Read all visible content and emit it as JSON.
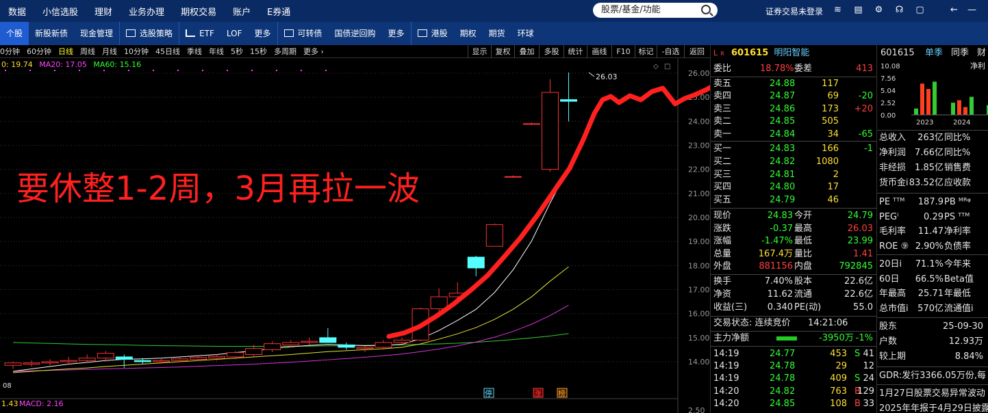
{
  "topbar": {
    "menu": [
      "数据",
      "小信选股",
      "理财",
      "业务办理",
      "期权交易",
      "账户",
      "E券通"
    ],
    "search_placeholder": "股票/基金/功能",
    "login_status": "证券交易未登录"
  },
  "secbar": {
    "items": [
      "个股",
      "新股新债",
      "现金管理",
      "选股策略",
      "ETF",
      "LOF",
      "更多",
      "可转债",
      "国债逆回购",
      "更多",
      "港股",
      "期权",
      "期货",
      "环球"
    ]
  },
  "periodbar": {
    "periods": [
      "0分钟",
      "60分钟",
      "日线",
      "周线",
      "月线",
      "10分钟",
      "45日线",
      "季线",
      "年线",
      "5秒",
      "15秒",
      "多周期",
      "更多 ›"
    ],
    "active": "日线",
    "buttons": [
      "显示",
      "复权",
      "叠加",
      "多股",
      "统计",
      "画线",
      "F10",
      "标记",
      "-自选",
      "返回"
    ]
  },
  "ma_legend": {
    "ma10": "0: 19.74",
    "ma20": "MA20: 17.05",
    "ma60": "MA60: 15.16"
  },
  "annotation_text": "要休整1-2周，3月再拉一波",
  "macd_legend": {
    "left": "1.43",
    "label": "MACD: 2.16"
  },
  "left_edge_label": "08",
  "price_axis": [
    "26.00",
    "25.00",
    "24.00",
    "23.00",
    "22.00",
    "21.00",
    "20.00",
    "19.00",
    "18.00",
    "17.00",
    "16.00",
    "15.00",
    "14.00",
    "2.50"
  ],
  "high_marker": "26.03",
  "event_markers": [
    {
      "text": "停",
      "color": "#66e0ff"
    },
    {
      "text": "涨",
      "color": "#ff4040"
    },
    {
      "text": "榜",
      "color": "#ffa030"
    }
  ],
  "chart_data": {
    "type": "candlestick",
    "ylim": [
      13.7,
      26.3
    ],
    "candles": [
      {
        "o": 13.85,
        "h": 14.0,
        "l": 13.7,
        "c": 13.95
      },
      {
        "o": 13.9,
        "h": 14.05,
        "l": 13.8,
        "c": 13.95
      },
      {
        "o": 13.95,
        "h": 14.1,
        "l": 13.85,
        "c": 14.0
      },
      {
        "o": 14.0,
        "h": 14.2,
        "l": 13.9,
        "c": 14.05
      },
      {
        "o": 14.05,
        "h": 14.3,
        "l": 13.95,
        "c": 14.15
      },
      {
        "o": 14.15,
        "h": 14.45,
        "l": 14.0,
        "c": 14.35
      },
      {
        "o": 14.2,
        "h": 14.3,
        "l": 13.75,
        "c": 14.1
      },
      {
        "o": 14.05,
        "h": 14.15,
        "l": 13.9,
        "c": 14.0
      },
      {
        "o": 14.0,
        "h": 14.12,
        "l": 13.92,
        "c": 14.05
      },
      {
        "o": 14.05,
        "h": 14.2,
        "l": 13.98,
        "c": 14.12
      },
      {
        "o": 14.1,
        "h": 14.25,
        "l": 14.02,
        "c": 14.18
      },
      {
        "o": 14.15,
        "h": 14.3,
        "l": 14.05,
        "c": 14.22
      },
      {
        "o": 14.2,
        "h": 14.45,
        "l": 14.1,
        "c": 14.38
      },
      {
        "o": 14.3,
        "h": 14.7,
        "l": 14.2,
        "c": 14.55
      },
      {
        "o": 14.5,
        "h": 14.85,
        "l": 14.4,
        "c": 14.75
      },
      {
        "o": 14.7,
        "h": 14.9,
        "l": 14.6,
        "c": 14.8
      },
      {
        "o": 14.8,
        "h": 15.0,
        "l": 14.7,
        "c": 14.85
      },
      {
        "o": 15.0,
        "h": 15.4,
        "l": 14.8,
        "c": 14.8
      },
      {
        "o": 14.7,
        "h": 14.8,
        "l": 14.5,
        "c": 14.6
      },
      {
        "o": 14.55,
        "h": 14.65,
        "l": 14.4,
        "c": 14.6
      },
      {
        "o": 14.6,
        "h": 14.9,
        "l": 14.5,
        "c": 14.8
      },
      {
        "o": 14.8,
        "h": 15.0,
        "l": 14.7,
        "c": 14.9
      },
      {
        "o": 14.9,
        "h": 16.25,
        "l": 14.85,
        "c": 16.2
      },
      {
        "o": 16.2,
        "h": 17.05,
        "l": 16.05,
        "c": 16.7
      },
      {
        "o": 16.7,
        "h": 17.3,
        "l": 16.4,
        "c": 16.85
      },
      {
        "o": 18.35,
        "h": 18.4,
        "l": 17.55,
        "c": 17.9
      },
      {
        "o": 18.8,
        "h": 19.75,
        "l": 18.8,
        "c": 19.7
      },
      {
        "o": 21.7,
        "h": 21.75,
        "l": 21.65,
        "c": 21.7
      },
      {
        "o": 23.9,
        "h": 23.95,
        "l": 23.85,
        "c": 23.9
      },
      {
        "o": 22.0,
        "h": 25.75,
        "l": 21.9,
        "c": 25.2
      },
      {
        "o": 24.9,
        "h": 26.03,
        "l": 23.99,
        "c": 24.83
      }
    ],
    "ma10": [
      13.6,
      13.7,
      13.8,
      13.9,
      13.97,
      14.05,
      14.1,
      14.12,
      14.15,
      14.2,
      14.25,
      14.3,
      14.38,
      14.45,
      14.55,
      14.62,
      14.68,
      14.72,
      14.7,
      14.67,
      14.68,
      14.72,
      14.95,
      15.3,
      15.72,
      16.18,
      16.88,
      17.82,
      19.02,
      20.6,
      22.05
    ],
    "ma20": [
      13.55,
      13.6,
      13.65,
      13.7,
      13.74,
      13.8,
      13.85,
      13.9,
      13.95,
      14.0,
      14.05,
      14.1,
      14.15,
      14.2,
      14.25,
      14.3,
      14.36,
      14.42,
      14.46,
      14.5,
      14.54,
      14.6,
      14.74,
      14.94,
      15.16,
      15.42,
      15.76,
      16.18,
      16.7,
      17.35,
      17.95
    ],
    "ma60": [
      13.6,
      13.62,
      13.64,
      13.66,
      13.68,
      13.7,
      13.72,
      13.74,
      13.76,
      13.78,
      13.81,
      13.84,
      13.87,
      13.9,
      13.94,
      13.98,
      14.03,
      14.08,
      14.13,
      14.19,
      14.25,
      14.32,
      14.42,
      14.53,
      14.66,
      14.82,
      15.02,
      15.26,
      15.56,
      15.92,
      16.35
    ],
    "ma_green": [
      14.8,
      14.78,
      14.76,
      14.74,
      14.72,
      14.71,
      14.7,
      14.68,
      14.67,
      14.66,
      14.65,
      14.64,
      14.64,
      14.64,
      14.64,
      14.64,
      14.65,
      14.66,
      14.67,
      14.68,
      14.69,
      14.7,
      14.72,
      14.74,
      14.77,
      14.81,
      14.86,
      14.92,
      14.99,
      15.07,
      15.17
    ]
  },
  "quote": {
    "code": "601615",
    "name": "明阳智能",
    "weibi_label": "委比",
    "weibi_value": "18.78%",
    "weicha_label": "委差",
    "weicha_value": "413",
    "asks": [
      {
        "label": "卖五",
        "price": "24.88",
        "vol": "117",
        "chg": ""
      },
      {
        "label": "卖四",
        "price": "24.87",
        "vol": "69",
        "chg": "-20"
      },
      {
        "label": "卖三",
        "price": "24.86",
        "vol": "173",
        "chg": "+20"
      },
      {
        "label": "卖二",
        "price": "24.85",
        "vol": "505",
        "chg": ""
      },
      {
        "label": "卖一",
        "price": "24.84",
        "vol": "34",
        "chg": "-65"
      }
    ],
    "bids": [
      {
        "label": "买一",
        "price": "24.83",
        "vol": "166",
        "chg": "-1"
      },
      {
        "label": "买二",
        "price": "24.82",
        "vol": "1080",
        "chg": ""
      },
      {
        "label": "买三",
        "price": "24.81",
        "vol": "2",
        "chg": ""
      },
      {
        "label": "买四",
        "price": "24.80",
        "vol": "17",
        "chg": ""
      },
      {
        "label": "买五",
        "price": "24.79",
        "vol": "46",
        "chg": ""
      }
    ],
    "stats": [
      {
        "l1": "现价",
        "v1": "24.83",
        "c1": "green",
        "l2": "今开",
        "v2": "24.79",
        "c2": "green"
      },
      {
        "l1": "涨跌",
        "v1": "-0.37",
        "c1": "green",
        "l2": "最高",
        "v2": "26.03",
        "c2": "red"
      },
      {
        "l1": "涨幅",
        "v1": "-1.47%",
        "c1": "green",
        "l2": "最低",
        "v2": "23.99",
        "c2": "green"
      },
      {
        "l1": "总量",
        "v1": "167.4万",
        "c1": "yellow",
        "l2": "量比",
        "v2": "1.41",
        "c2": "red"
      },
      {
        "l1": "外盘",
        "v1": "881156",
        "c1": "red",
        "l2": "内盘",
        "v2": "792845",
        "c2": "green"
      }
    ],
    "stats2": [
      {
        "l1": "换手",
        "v1": "7.40%",
        "l2": "股本",
        "v2": "22.6亿"
      },
      {
        "l1": "净资",
        "v1": "11.62",
        "l2": "流通",
        "v2": "22.6亿"
      },
      {
        "l1": "收益(三)",
        "v1": "0.340",
        "l2": "PE(动)",
        "v2": "55.0"
      }
    ],
    "trade_status_label": "交易状态: 连续竞价",
    "trade_time": "14:21:06",
    "net_label": "主力净额",
    "net_value": "-3950万",
    "net_pct": "-1%",
    "ticks": [
      {
        "time": "14:19",
        "price": "24.77",
        "vol": "453",
        "side": "S",
        "n": "41"
      },
      {
        "time": "14:19",
        "price": "24.78",
        "vol": "29",
        "side": "",
        "n": "12"
      },
      {
        "time": "14:19",
        "price": "24.78",
        "vol": "409",
        "side": "S",
        "n": "24"
      },
      {
        "time": "14:20",
        "price": "24.82",
        "vol": "763",
        "side": "B",
        "n": "129"
      },
      {
        "time": "14:20",
        "price": "24.85",
        "vol": "108",
        "side": "B",
        "n": "33"
      }
    ]
  },
  "finance": {
    "code": "601615",
    "tabs": [
      "单季",
      "同季",
      "财"
    ],
    "net_label": "净利",
    "axis": [
      "10.08",
      "7.56",
      "5.04",
      "2.52",
      "0.00"
    ],
    "years": [
      "2023",
      "2024"
    ],
    "bars_2023": [
      1.3,
      6.4,
      5.3,
      6.8
    ],
    "bars_2024": [
      2.5,
      3.0,
      1.6,
      3.7
    ],
    "bars_extra": [
      2.0
    ],
    "rows1": [
      {
        "label": "总收入",
        "value": "263亿",
        "extra": "同比%"
      },
      {
        "label": "净利润",
        "value": "7.66亿",
        "extra": "同比%"
      },
      {
        "label": "非经损",
        "value": "1.85亿",
        "extra": "销售费"
      },
      {
        "label": "货币金i",
        "value": "83.52亿",
        "extra": "应收款"
      }
    ],
    "rows2": [
      {
        "label": "PE ᵀᵀᴹ",
        "value": "187.9",
        "extra": "PB ᴹᴿᵠ"
      },
      {
        "label": "PEGⁱ",
        "value": "0.29",
        "extra": "PS ᵀᵀᴹ"
      },
      {
        "label": "毛利率",
        "value": "11.47",
        "extra": "净利率"
      },
      {
        "label": "ROE ⑨",
        "value": "2.90%",
        "extra": "负债率"
      }
    ],
    "rows3": [
      {
        "label": "20日i",
        "value": "71.1%",
        "extra": "今年来"
      },
      {
        "label": "60日",
        "value": "66.5%",
        "extra": "Beta值"
      },
      {
        "label": "年最高",
        "value": "25.71",
        "extra": "年最低"
      },
      {
        "label": "总市值i",
        "value": "570亿",
        "extra": "流通值i"
      }
    ],
    "rows4": [
      {
        "label": "股东",
        "value": "25-09-30"
      },
      {
        "label": "户数",
        "value": "12.93万"
      },
      {
        "label": "较上期",
        "value": "8.84%"
      }
    ],
    "gdr": "GDR:发行3366.05万份,每",
    "news1": "1月27日股票交易异常波动",
    "news2": "2025年年报于4月29日披露"
  }
}
